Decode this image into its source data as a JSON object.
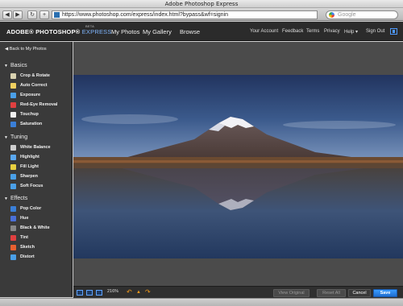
{
  "window": {
    "title": "Adobe Photoshop Express"
  },
  "browser": {
    "url": "https://www.photoshop.com/express/index.html?bypass&wf=signin",
    "search_placeholder": "Google",
    "back_glyph": "◀",
    "forward_glyph": "▶",
    "reload_glyph": "↻",
    "add_glyph": "+"
  },
  "app": {
    "brand": "ADOBE® PHOTOSHOP®",
    "brand_express": "EXPRESS",
    "beta": "BETA",
    "main_nav": [
      "My Photos",
      "My Gallery",
      "Browse"
    ],
    "top_nav": [
      "Your Account",
      "Feedback",
      "Terms",
      "Privacy",
      "Help ▾",
      "Sign Out"
    ]
  },
  "sidebar": {
    "back_label": "Back to My Photos",
    "sections": [
      {
        "title": "Basics",
        "tools": [
          {
            "label": "Crop & Rotate",
            "icon": "crop-icon",
            "color": "#d9d2b0"
          },
          {
            "label": "Auto Correct",
            "icon": "wand-icon",
            "color": "#f0d060"
          },
          {
            "label": "Exposure",
            "icon": "exposure-icon",
            "color": "#4aa0e8"
          },
          {
            "label": "Red-Eye Removal",
            "icon": "red-eye-icon",
            "color": "#e04040"
          },
          {
            "label": "Touchup",
            "icon": "hand-icon",
            "color": "#f0f0f0"
          },
          {
            "label": "Saturation",
            "icon": "saturation-icon",
            "color": "#3a7fd8"
          }
        ]
      },
      {
        "title": "Tuning",
        "tools": [
          {
            "label": "White Balance",
            "icon": "white-balance-icon",
            "color": "#cfcfcf"
          },
          {
            "label": "Highlight",
            "icon": "highlight-icon",
            "color": "#5aa8f0"
          },
          {
            "label": "Fill Light",
            "icon": "fill-light-icon",
            "color": "#e8d040"
          },
          {
            "label": "Sharpen",
            "icon": "sharpen-icon",
            "color": "#4aa0e8"
          },
          {
            "label": "Soft Focus",
            "icon": "soft-focus-icon",
            "color": "#4aa0e8"
          }
        ]
      },
      {
        "title": "Effects",
        "tools": [
          {
            "label": "Pop Color",
            "icon": "pop-color-icon",
            "color": "#3a7fd8"
          },
          {
            "label": "Hue",
            "icon": "hue-icon",
            "color": "#4a70d8"
          },
          {
            "label": "Black & White",
            "icon": "black-white-icon",
            "color": "#888888"
          },
          {
            "label": "Tint",
            "icon": "tint-icon",
            "color": "#e04040"
          },
          {
            "label": "Sketch",
            "icon": "sketch-icon",
            "color": "#e86030"
          },
          {
            "label": "Distort",
            "icon": "distort-icon",
            "color": "#4aa0e8"
          }
        ]
      }
    ]
  },
  "canvas": {
    "photo_description_icon": "mountain-photo"
  },
  "bottom": {
    "zoom": "216%",
    "undo_glyph": "↶",
    "up_glyph": "▲",
    "redo_glyph": "↷",
    "view_original": "View Original",
    "reset_all": "Reset All",
    "cancel": "Cancel",
    "save": "Save"
  },
  "colors": {
    "accent": "#2f8cf0",
    "arrow": "#f39a1a"
  }
}
